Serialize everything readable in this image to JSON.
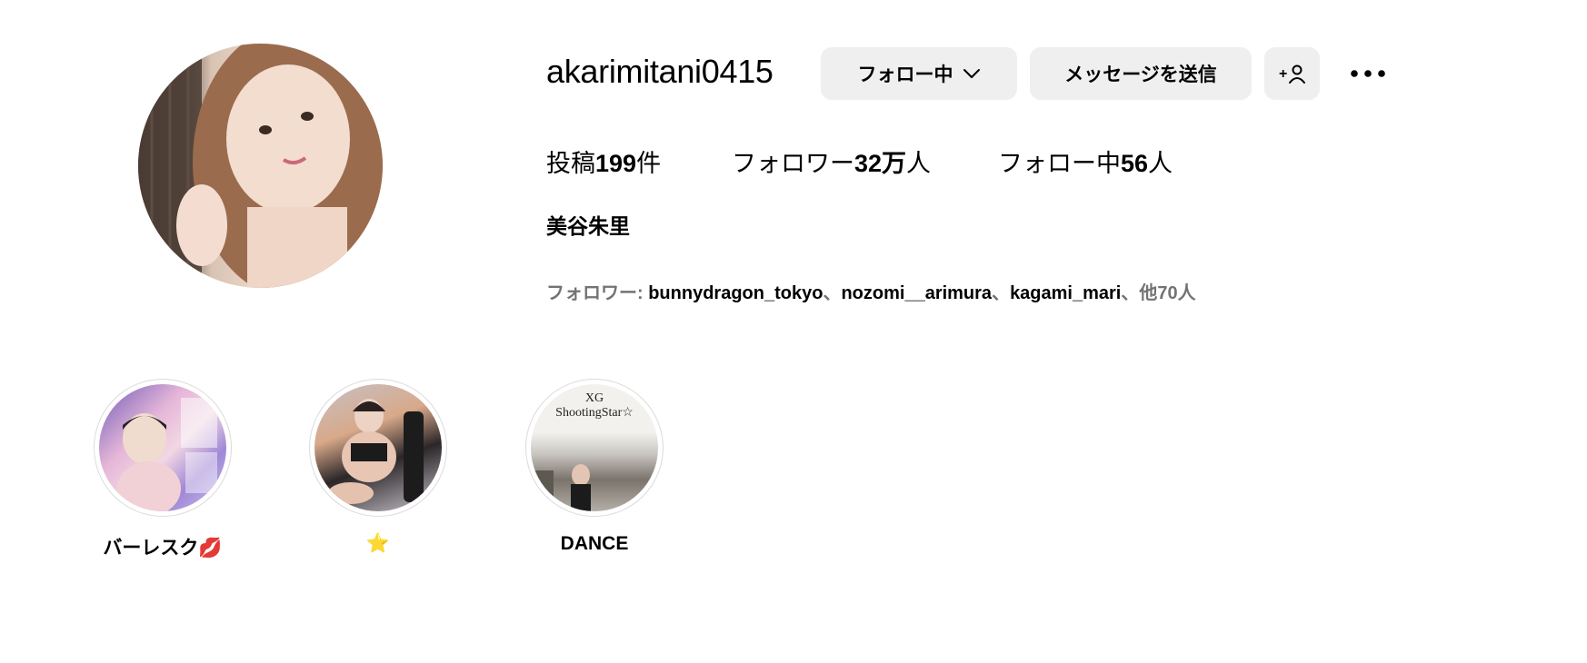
{
  "profile": {
    "username": "akarimitani0415",
    "full_name": "美谷朱里",
    "avatar_icon": "profile-photo"
  },
  "actions": {
    "following_label": "フォロー中",
    "message_label": "メッセージを送信",
    "add_user_label": "+",
    "more_icon": "more-dots-icon"
  },
  "stats": {
    "posts_prefix": "投稿",
    "posts_value": "199",
    "posts_suffix": "件",
    "followers_prefix": "フォロワー",
    "followers_value": "32万",
    "followers_suffix": "人",
    "following_prefix": "フォロー中",
    "following_value": "56",
    "following_suffix": "人"
  },
  "followed_by": {
    "prefix": "フォロワー: ",
    "accounts": [
      "bunnydragon_tokyo",
      "nozomi__arimura",
      "kagami_mari"
    ],
    "separator": "、",
    "more": "他70人"
  },
  "highlights": [
    {
      "label": "バーレスク💋"
    },
    {
      "label": "⭐"
    },
    {
      "label": "DANCE",
      "cover_text_1": "XG",
      "cover_text_2": "ShootingStar☆"
    }
  ]
}
